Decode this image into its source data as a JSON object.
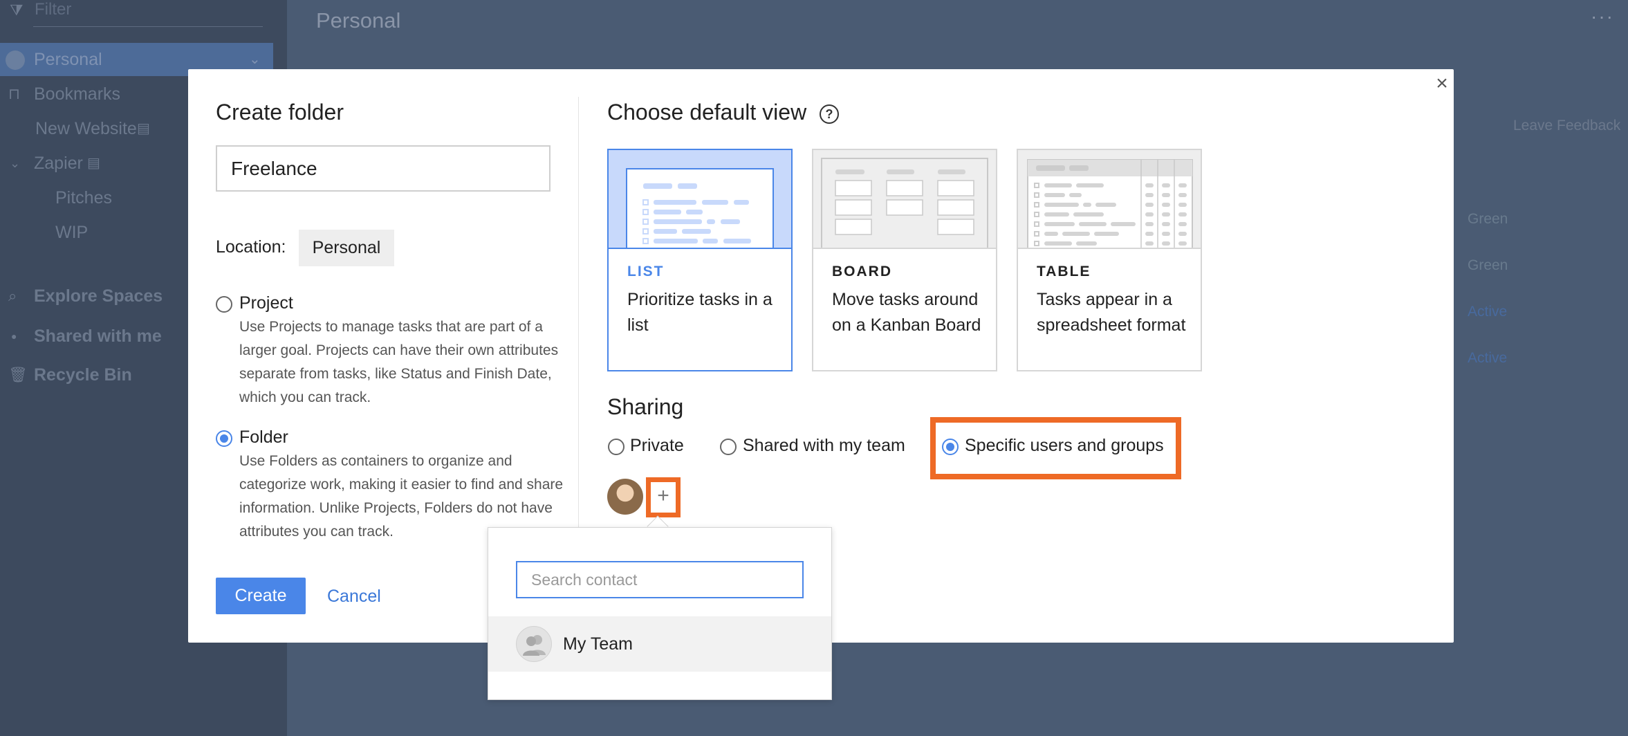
{
  "sidebar": {
    "filter_placeholder": "Filter",
    "items": [
      {
        "label": "Personal"
      },
      {
        "label": "Bookmarks"
      },
      {
        "label": "New Website"
      },
      {
        "label": "Zapier"
      },
      {
        "label": "Pitches"
      },
      {
        "label": "WIP"
      },
      {
        "label": "Explore Spaces"
      },
      {
        "label": "Shared with me"
      },
      {
        "label": "Recycle Bin"
      }
    ]
  },
  "main": {
    "title": "Personal",
    "more_label": "···",
    "leave_feedback": "Leave Feedback",
    "statuses": [
      "Green",
      "Green",
      "Active",
      "Active"
    ]
  },
  "modal": {
    "close_label": "×",
    "create_title": "Create folder",
    "folder_name": "Freelance",
    "location_label": "Location:",
    "location_value": "Personal",
    "types": [
      {
        "label": "Project",
        "desc": "Use Projects to manage tasks that are part of a larger goal. Projects can have their own attributes separate from tasks, like Status and Finish Date, which you can track.",
        "selected": false
      },
      {
        "label": "Folder",
        "desc": "Use Folders as containers to organize and categorize work, making it easier to find and share information. Unlike Projects, Folders do not have attributes you can track.",
        "selected": true
      }
    ],
    "create_label": "Create",
    "cancel_label": "Cancel",
    "choose_title": "Choose default view",
    "help_label": "?",
    "views": [
      {
        "name": "LIST",
        "desc": "Prioritize tasks in a list",
        "selected": true
      },
      {
        "name": "BOARD",
        "desc": "Move tasks around on a Kanban Board",
        "selected": false
      },
      {
        "name": "TABLE",
        "desc": "Tasks appear in a spreadsheet format",
        "selected": false
      }
    ],
    "sharing_title": "Sharing",
    "sharing_options": [
      {
        "label": "Private",
        "selected": false
      },
      {
        "label": "Shared with my team",
        "selected": false
      },
      {
        "label": "Specific users and groups",
        "selected": true
      }
    ],
    "add_label": "+"
  },
  "popup": {
    "search_placeholder": "Search contact",
    "team_label": "My Team"
  },
  "colors": {
    "accent": "#4a86e8",
    "highlight": "#ee6a26",
    "backdrop": "#4a5b73"
  }
}
